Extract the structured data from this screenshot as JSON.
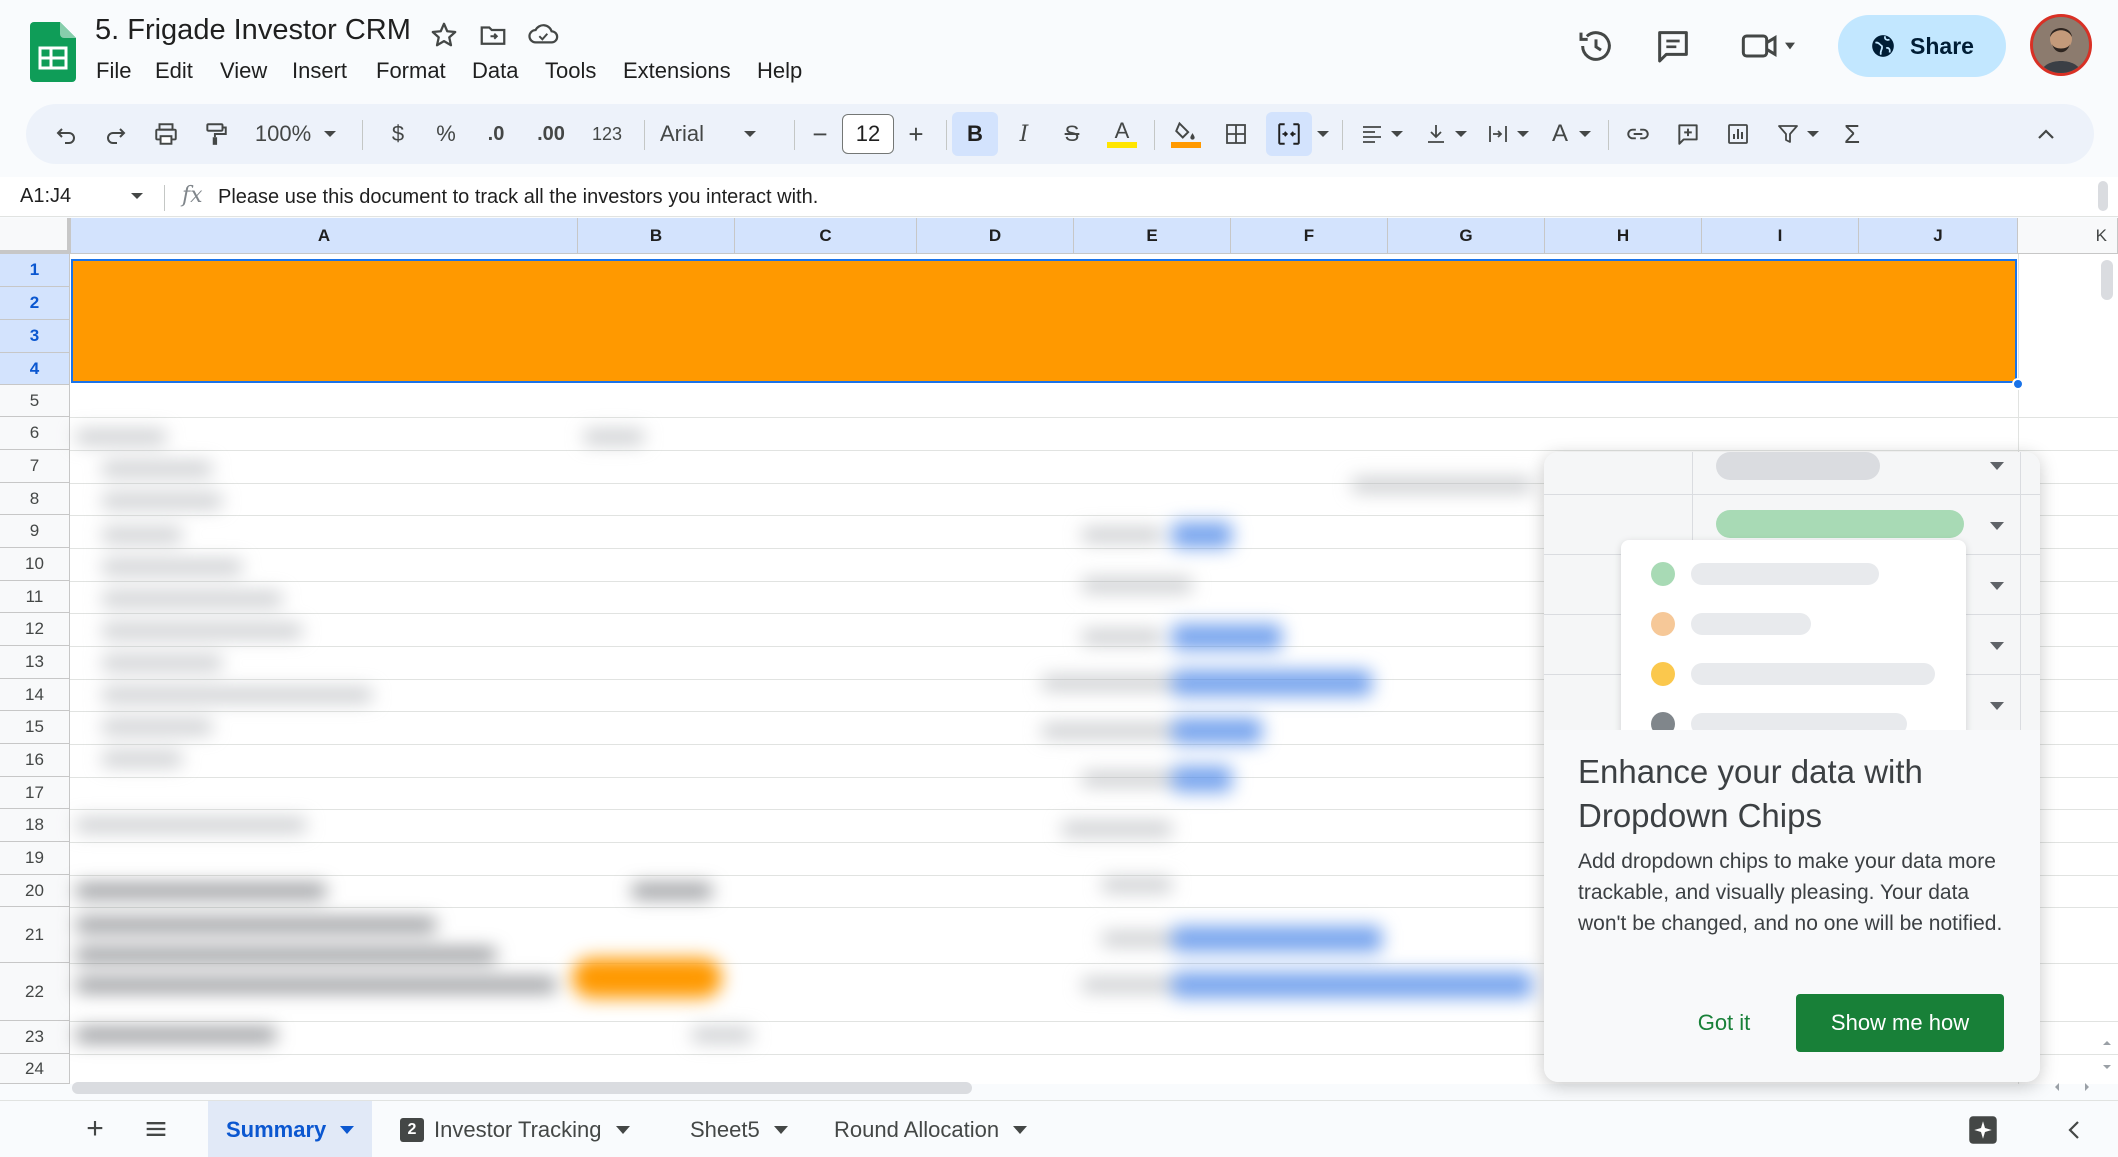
{
  "document": {
    "title": "5. Frigade Investor CRM"
  },
  "menu": [
    "File",
    "Edit",
    "View",
    "Insert",
    "Format",
    "Data",
    "Tools",
    "Extensions",
    "Help"
  ],
  "header": {
    "share_label": "Share"
  },
  "toolbar": {
    "zoom": "100%",
    "currency": "$",
    "percent": "%",
    "decrease_decimal": ".0",
    "increase_decimal": ".00",
    "number_format": "123",
    "font": "Arial",
    "font_size": "12",
    "minus": "−",
    "plus": "+",
    "bold": "B",
    "italic": "I",
    "strikethrough": "S",
    "text_color": "A",
    "text_rotation": "A",
    "sum": "Σ"
  },
  "formula_bar": {
    "name_box": "A1:J4",
    "fx": "fx",
    "content": "Please use this document to track all the investors you interact with."
  },
  "grid": {
    "columns": [
      "A",
      "B",
      "C",
      "D",
      "E",
      "F",
      "G",
      "H",
      "I",
      "J",
      "K"
    ],
    "rows": [
      "1",
      "2",
      "3",
      "4",
      "5",
      "6",
      "7",
      "8",
      "9",
      "10",
      "11",
      "12",
      "13",
      "14",
      "15",
      "16",
      "17",
      "18",
      "19",
      "20",
      "21",
      "22",
      "23",
      "24"
    ],
    "selection_fill": "#ff9900"
  },
  "popup": {
    "title": "Enhance your data with Dropdown Chips",
    "body": "Add dropdown chips to make your data more trackable, and visually pleasing. Your data won't be changed, and no one will be notified.",
    "dismiss_label": "Got it",
    "action_label": "Show me how"
  },
  "sheets": {
    "add": "+",
    "tabs": [
      {
        "label": "Summary",
        "active": true
      },
      {
        "label": "Investor Tracking",
        "badge": "2"
      },
      {
        "label": "Sheet5"
      },
      {
        "label": "Round Allocation"
      }
    ]
  },
  "colors": {
    "accent": "#0b57d0",
    "share_bg": "#c2e7ff",
    "primary_button": "#188038",
    "orange": "#ff9900"
  }
}
